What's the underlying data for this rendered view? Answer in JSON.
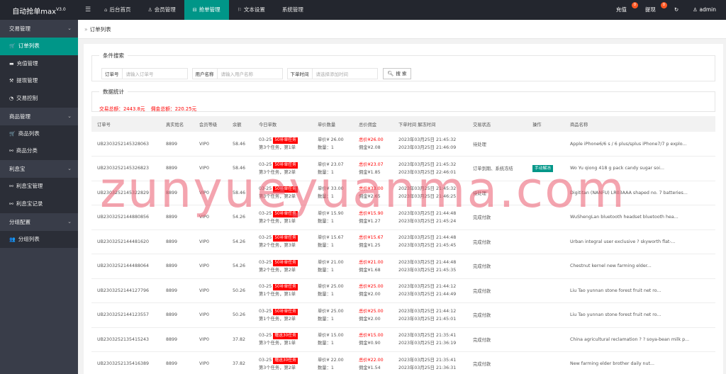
{
  "app": {
    "title": "自动抢单max",
    "version": "V3.0"
  },
  "topnav": [
    {
      "label": "后台首页",
      "icon": "home-icon",
      "glyph": "⌂",
      "active": false
    },
    {
      "label": "会员管理",
      "icon": "user-icon",
      "glyph": "♙",
      "active": false
    },
    {
      "label": "抢单管理",
      "icon": "grab-order-icon",
      "glyph": "⊟",
      "active": true
    },
    {
      "label": "文本设置",
      "icon": "flag-icon",
      "glyph": "⚐",
      "active": false
    },
    {
      "label": "系统管理",
      "icon": "",
      "glyph": "",
      "active": false
    }
  ],
  "rightnav": {
    "recharge": {
      "label": "充值",
      "badge": "0"
    },
    "withdraw": {
      "label": "提现",
      "badge": "0"
    },
    "refresh_glyph": "↻",
    "user": "admin",
    "user_glyph": "♙",
    "menu_glyph": "☰"
  },
  "sidebar": {
    "groups": [
      {
        "label": "交易管理",
        "items": [
          {
            "label": "订单列表",
            "icon": "cart-icon",
            "glyph": "🛒",
            "active": true
          },
          {
            "label": "充值管理",
            "icon": "comment-icon",
            "glyph": "▬",
            "active": false
          },
          {
            "label": "提现管理",
            "icon": "hammer-icon",
            "glyph": "⚒",
            "active": false
          },
          {
            "label": "交易控制",
            "icon": "dashboard-icon",
            "glyph": "◔",
            "active": false
          }
        ]
      },
      {
        "label": "商品管理",
        "items": [
          {
            "label": "商品列表",
            "icon": "cart-icon",
            "glyph": "🛒",
            "active": false
          },
          {
            "label": "商品分类",
            "icon": "link-icon",
            "glyph": "⚯",
            "active": false
          }
        ]
      },
      {
        "label": "利息宝",
        "items": [
          {
            "label": "利息宝管理",
            "icon": "link-icon",
            "glyph": "⚯",
            "active": false
          },
          {
            "label": "利息宝记录",
            "icon": "link-icon",
            "glyph": "⚯",
            "active": false
          }
        ]
      },
      {
        "label": "分组配置",
        "items": [
          {
            "label": "分组列表",
            "icon": "users-icon",
            "glyph": "👥",
            "active": false
          }
        ]
      }
    ]
  },
  "breadcrumb": {
    "label": "订单列表"
  },
  "search": {
    "legend": "条件搜索",
    "order_no_label": "订单号",
    "order_no_placeholder": "请输入订单号",
    "username_label": "用户名称",
    "username_placeholder": "请输入用户名称",
    "time_label": "下单时间",
    "time_placeholder": "请选择添加时间",
    "button": "搜 索"
  },
  "stats": {
    "legend": "数据统计",
    "total_trade": "交易总额：2443.8元",
    "total_commission": "佣金总额：220.25元"
  },
  "table": {
    "headers": [
      "订单号",
      "真实姓名",
      "会员等级",
      "余额",
      "今日单数",
      "单价数量",
      "总价佣金",
      "下单时间 解冻时间",
      "交易状态",
      "操作",
      "商品名称"
    ],
    "rows": [
      {
        "order_no": "UB2303252145328063",
        "name": "8899",
        "level": "VIP0",
        "balance": "58.46",
        "date": "03-25",
        "task": "50补单任务",
        "task_info": "第3个任务，第1单",
        "unit_price": "单价¥ 26.00",
        "qty": "数量：1",
        "total": "总价¥26.00",
        "commission": "佣金¥2.08",
        "order_time": "2023年03月25日 21:45:32",
        "unfreeze_time": "2023年03月25日 21:46:09",
        "status": "待处理",
        "action": "",
        "goods": "Apple iPhone6/6 s / 6 plus/splus iPhone7/7 p explo..."
      },
      {
        "order_no": "UB2303252145326823",
        "name": "8899",
        "level": "VIP0",
        "balance": "58.46",
        "date": "03-25",
        "task": "50补单任务",
        "task_info": "第3个任务，第2单",
        "unit_price": "单价¥ 23.07",
        "qty": "数量：1",
        "total": "总价¥23.07",
        "commission": "佣金¥1.85",
        "order_time": "2023年03月25日 21:45:32",
        "unfreeze_time": "2023年03月25日 22:46:01",
        "status": "订单到期、系统冻结",
        "action": "手动解冻",
        "goods": "Wo Yu qiong 418 g pack candy sugar soi..."
      },
      {
        "order_no": "UB2303252145322829",
        "name": "8899",
        "level": "VIP0",
        "balance": "58.46",
        "date": "03-25",
        "task": "50补单任务",
        "task_info": "第3个任务，第2单",
        "unit_price": "单价¥ 33.00",
        "qty": "数量：1",
        "total": "总价¥33.00",
        "commission": "佣金¥2.65",
        "order_time": "2023年03月25日 21:45:32",
        "unfreeze_time": "2023年03月25日 21:46:25",
        "status": "待处理",
        "action": "",
        "goods": "Digititan (NANFU) LR03AAA shaped no. 7 batteries..."
      },
      {
        "order_no": "UB2303252144880856",
        "name": "8899",
        "level": "VIP0",
        "balance": "54.26",
        "date": "03-25",
        "task": "50补单任务",
        "task_info": "第2个任务，第1单",
        "unit_price": "单价¥ 15.90",
        "qty": "数量：1",
        "total": "总价¥15.90",
        "commission": "佣金¥1.27",
        "order_time": "2023年03月25日 21:44:48",
        "unfreeze_time": "2023年03月25日 21:45:24",
        "status": "完成付款",
        "action": "",
        "goods": "WuShengLan bluetooth headset bluetooth hea..."
      },
      {
        "order_no": "UB2303252144481620",
        "name": "8899",
        "level": "VIP0",
        "balance": "54.26",
        "date": "03-25",
        "task": "50补单任务",
        "task_info": "第2个任务，第3单",
        "unit_price": "单价¥ 15.67",
        "qty": "数量：1",
        "total": "总价¥15.67",
        "commission": "佣金¥1.25",
        "order_time": "2023年03月25日 21:44:48",
        "unfreeze_time": "2023年03月25日 21:45:45",
        "status": "完成付款",
        "action": "",
        "goods": "Urban integral user exclusive ? skyworth flat-..."
      },
      {
        "order_no": "UB2303252144488064",
        "name": "8899",
        "level": "VIP0",
        "balance": "54.26",
        "date": "03-25",
        "task": "50补单任务",
        "task_info": "第2个任务，第2单",
        "unit_price": "单价¥ 21.00",
        "qty": "数量：1",
        "total": "总价¥21.00",
        "commission": "佣金¥1.68",
        "order_time": "2023年03月25日 21:44:48",
        "unfreeze_time": "2023年03月25日 21:45:35",
        "status": "完成付款",
        "action": "",
        "goods": "Chestnut kernel new farming elder..."
      },
      {
        "order_no": "UB2303252144127796",
        "name": "8899",
        "level": "VIP0",
        "balance": "50.26",
        "date": "03-25",
        "task": "50补单任务",
        "task_info": "第1个任务，第1单",
        "unit_price": "单价¥ 25.00",
        "qty": "数量：1",
        "total": "总价¥25.00",
        "commission": "佣金¥2.00",
        "order_time": "2023年03月25日 21:44:12",
        "unfreeze_time": "2023年03月25日 21:44:49",
        "status": "完成付款",
        "action": "",
        "goods": "Liu Tao yunnan stone forest fruit net ro..."
      },
      {
        "order_no": "UB2303252144123557",
        "name": "8899",
        "level": "VIP0",
        "balance": "50.26",
        "date": "03-25",
        "task": "50补单任务",
        "task_info": "第1个任务，第2单",
        "unit_price": "单价¥ 25.00",
        "qty": "数量：1",
        "total": "总价¥25.00",
        "commission": "佣金¥2.00",
        "order_time": "2023年03月25日 21:44:12",
        "unfreeze_time": "2023年03月25日 21:45:01",
        "status": "完成付款",
        "action": "",
        "goods": "Liu Tao yunnan stone forest fruit net ro..."
      },
      {
        "order_no": "UB2303252135415243",
        "name": "8899",
        "level": "VIP0",
        "balance": "37.82",
        "date": "03-25",
        "task": "赠送30任务",
        "task_info": "第3个任务，第1单",
        "unit_price": "单价¥ 15.00",
        "qty": "数量：1",
        "total": "总价¥15.00",
        "commission": "佣金¥0.90",
        "order_time": "2023年03月25日 21:35:41",
        "unfreeze_time": "2023年03月25日 21:36:19",
        "status": "完成付款",
        "action": "",
        "goods": "China agricultural reclamation ? ? soya-bean milk p..."
      },
      {
        "order_no": "UB2303252135416389",
        "name": "8899",
        "level": "VIP0",
        "balance": "37.82",
        "date": "03-25",
        "task": "赠送30任务",
        "task_info": "第3个任务，第2单",
        "unit_price": "单价¥ 22.00",
        "qty": "数量：1",
        "total": "总价¥22.00",
        "commission": "佣金¥1.54",
        "order_time": "2023年03月25日 21:35:41",
        "unfreeze_time": "2023年03月25日 21:36:31",
        "status": "完成付款",
        "action": "",
        "goods": "New farming elder brother daily nut..."
      }
    ]
  },
  "watermark": "zunyueyuanma.com",
  "colors": {
    "accent": "#009688",
    "topbar": "#23262e",
    "sidebar": "#393d49",
    "danger": "#ff0000",
    "badge": "#ff5722"
  }
}
